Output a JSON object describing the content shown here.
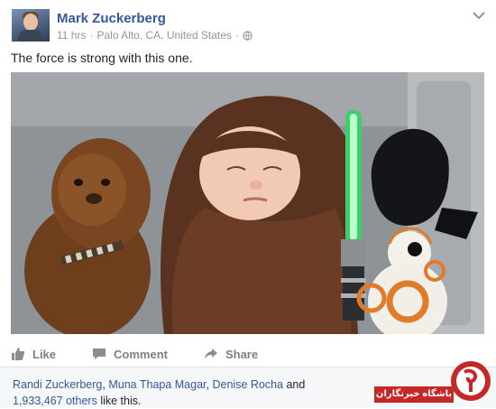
{
  "post": {
    "author": "Mark Zuckerberg",
    "time": "11 hrs",
    "location": "Palo Alto, CA, United States",
    "separator": "·",
    "privacy_icon": "globe-icon",
    "text": "The force is strong with this one."
  },
  "actions": {
    "like": "Like",
    "comment": "Comment",
    "share": "Share"
  },
  "likes": {
    "names": [
      "Randi Zuckerberg",
      "Muna Thapa Magar",
      "Denise Rocha"
    ],
    "comma": ",",
    "and": "and",
    "others_count": "1,933,467 others",
    "suffix": "like this."
  },
  "watermark": {
    "label": "باشگاه خبرنگاران"
  },
  "colors": {
    "link": "#365899",
    "meta": "#90949c",
    "action": "#7f7f7f",
    "watermark_red": "#c62828"
  }
}
